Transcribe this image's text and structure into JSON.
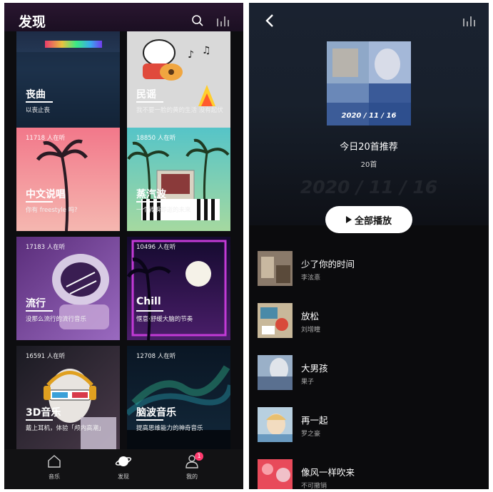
{
  "discover": {
    "title": "发现",
    "cards": [
      {
        "title": "丧曲",
        "listeners": "",
        "desc": "以丧止丧"
      },
      {
        "title": "民谣",
        "listeners": "",
        "desc": "我不要一脸的黄的生活 没有起伏"
      },
      {
        "title": "中文说唱",
        "listeners": "11718 人在听",
        "desc": "你有 freestyle 吗?"
      },
      {
        "title": "蒸汽波",
        "listeners": "18850 人在听",
        "desc": "一个转瞬即逝的未来"
      },
      {
        "title": "流行",
        "listeners": "17183 人在听",
        "desc": "没那么流行的流行音乐"
      },
      {
        "title": "Chill",
        "listeners": "10496 人在听",
        "desc": "惬意·舒缓大脑的节奏"
      },
      {
        "title": "3D音乐",
        "listeners": "16591 人在听",
        "desc": "戴上耳机，体验「颅内高潮」"
      },
      {
        "title": "脑波音乐",
        "listeners": "12708 人在听",
        "desc": "提高思维能力的神奇音乐"
      }
    ],
    "nav": [
      {
        "label": "音乐",
        "icon": "home-icon"
      },
      {
        "label": "发现",
        "icon": "planet-icon"
      },
      {
        "label": "我的",
        "icon": "user-icon",
        "badge": "1"
      }
    ]
  },
  "playlist": {
    "cover_date": "2020 / 11 / 16",
    "title": "今日20首推荐",
    "count": "20首",
    "background_date": "2020 / 11 / 16",
    "play_all_label": "全部播放",
    "songs": [
      {
        "name": "少了你的时间",
        "artist": "李泫憙"
      },
      {
        "name": "放松",
        "artist": "刘增瞳"
      },
      {
        "name": "大男孩",
        "artist": "果子"
      },
      {
        "name": "再一起",
        "artist": "罗之豪"
      },
      {
        "name": "像风一样吹来",
        "artist": "不可撤销"
      }
    ]
  },
  "colors": {
    "accent_badge": "#ff3a6e",
    "play_button_bg": "#ffffff"
  }
}
